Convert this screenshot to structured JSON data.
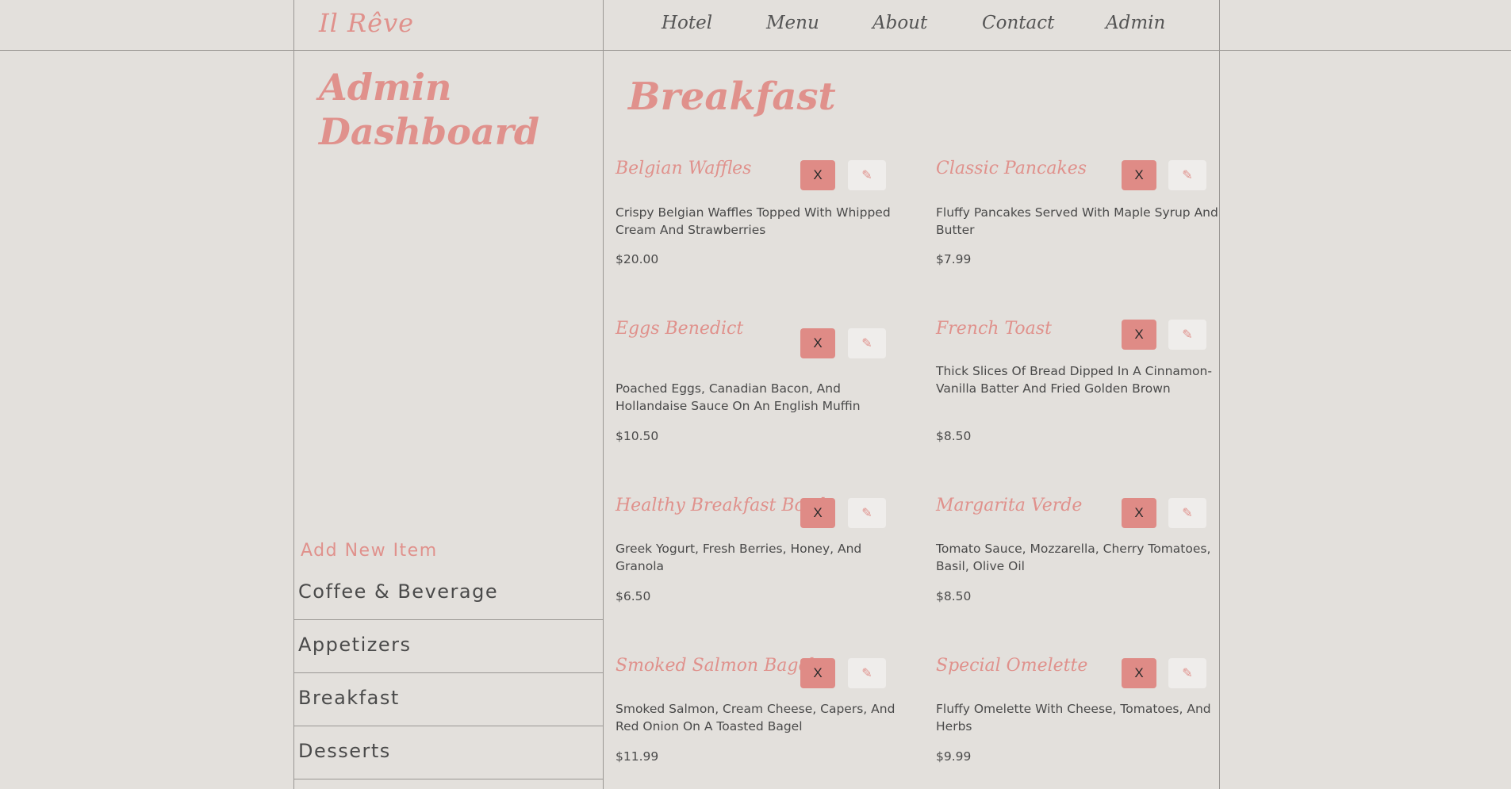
{
  "header": {
    "logo": "Il Rêve",
    "nav": [
      {
        "label": "Hotel"
      },
      {
        "label": "Menu"
      },
      {
        "label": "About"
      },
      {
        "label": "Contact"
      },
      {
        "label": "Admin"
      }
    ]
  },
  "sidebar": {
    "title": "Admin Dashboard",
    "add_new_label": "Add New Item",
    "categories": [
      {
        "label": "Coffee & Beverage"
      },
      {
        "label": "Appetizers"
      },
      {
        "label": "Breakfast"
      },
      {
        "label": "Desserts"
      }
    ]
  },
  "main": {
    "heading": "Breakfast",
    "delete_label": "X",
    "edit_icon": "pencil-icon",
    "items": [
      {
        "name": "Belgian Waffles",
        "description": "Crispy Belgian Waffles Topped With Whipped Cream And Strawberries",
        "price": "$20.00"
      },
      {
        "name": "Classic Pancakes",
        "description": "Fluffy Pancakes Served With Maple Syrup And Butter",
        "price": "$7.99"
      },
      {
        "name": "Eggs Benedict",
        "description": "Poached Eggs, Canadian Bacon, And Hollandaise Sauce On An English Muffin",
        "price": "$10.50"
      },
      {
        "name": "French Toast",
        "description": "Thick Slices Of Bread Dipped In A Cinnamon-Vanilla Batter And Fried Golden Brown",
        "price": "$8.50"
      },
      {
        "name": "Healthy Breakfast Bowl",
        "description": "Greek Yogurt, Fresh Berries, Honey, And Granola",
        "price": "$6.50"
      },
      {
        "name": "Margarita Verde",
        "description": "Tomato Sauce, Mozzarella, Cherry Tomatoes, Basil, Olive Oil",
        "price": "$8.50"
      },
      {
        "name": "Smoked Salmon Bagel",
        "description": "Smoked Salmon, Cream Cheese, Capers, And Red Onion On A Toasted Bagel",
        "price": "$11.99"
      },
      {
        "name": "Special Omelette",
        "description": "Fluffy Omelette With Cheese, Tomatoes, And Herbs",
        "price": "$9.99"
      }
    ]
  },
  "colors": {
    "accent": "#e0918c",
    "background": "#e3e0dc",
    "delete_button": "#df8b86",
    "edit_button": "#efedeb",
    "border": "#9a9794"
  }
}
